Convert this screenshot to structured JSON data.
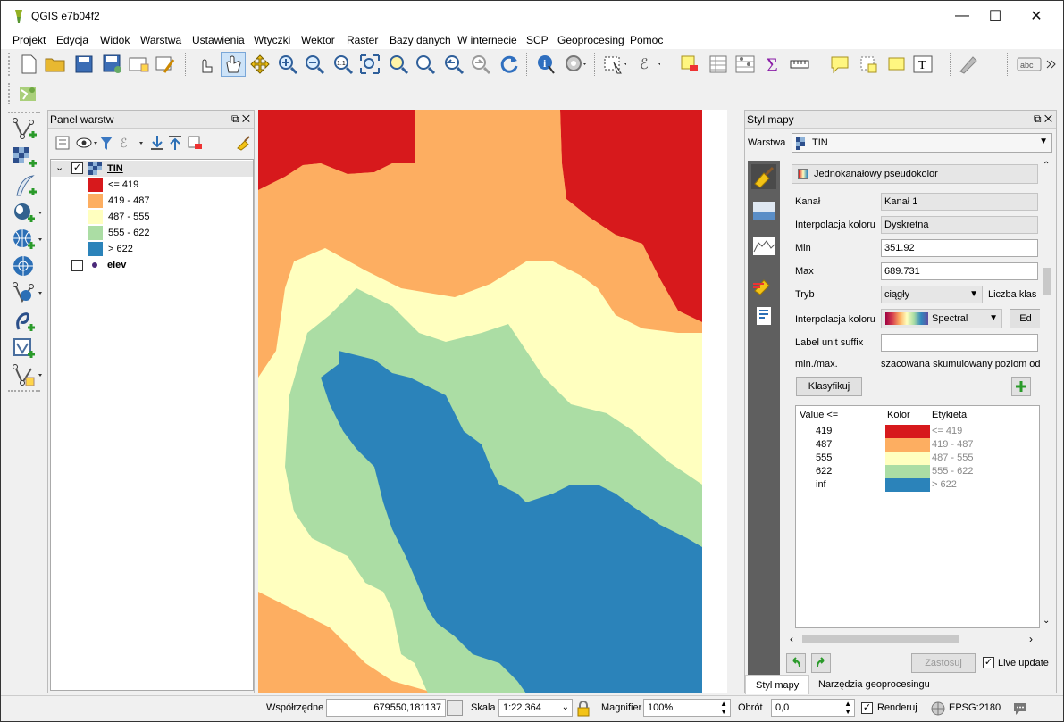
{
  "window": {
    "title": "QGIS e7b04f2"
  },
  "menu": [
    "Projekt",
    "Edycja",
    "Widok",
    "Warstwa",
    "Ustawienia",
    "Wtyczki",
    "Wektor",
    "Raster",
    "Bazy danych",
    "W internecie",
    "SCP",
    "Geoprocesing",
    "Pomoc"
  ],
  "layers_panel": {
    "title": "Panel warstw",
    "layers": [
      {
        "name": "TIN",
        "checked": true,
        "legend": [
          {
            "label": "<= 419",
            "color": "#d7191c"
          },
          {
            "label": "419 - 487",
            "color": "#fdae61"
          },
          {
            "label": "487 - 555",
            "color": "#ffffbf"
          },
          {
            "label": "555 - 622",
            "color": "#abdda4"
          },
          {
            "label": "> 622",
            "color": "#2b83ba"
          }
        ]
      },
      {
        "name": "elev",
        "checked": false
      }
    ]
  },
  "style_panel": {
    "title": "Styl mapy",
    "layer_label": "Warstwa",
    "layer_value": "TIN",
    "renderer": "Jednokanałowy pseudokolor",
    "band_label": "Kanał",
    "band_value": "Kanał 1",
    "interp_label": "Interpolacja koloru",
    "interp_value": "Dyskretna",
    "min_label": "Min",
    "min_value": "351.92",
    "max_label": "Max",
    "max_value": "689.731",
    "mode_label": "Tryb",
    "mode_value": "ciągły",
    "classes_label": "Liczba klas",
    "ramp_label": "Interpolacja koloru",
    "ramp_value": "Spectral",
    "edit_label": "Ed",
    "suffix_label": "Label unit suffix",
    "suffix_value": "",
    "minmax_label": "min./max.",
    "minmax_value": "szacowana skumulowany poziom odc",
    "classify_button": "Klasyfikuj",
    "table_headers": [
      "Value <=",
      "Kolor",
      "Etykieta"
    ],
    "table_rows": [
      {
        "value": "419",
        "color": "#d7191c",
        "label": "<= 419"
      },
      {
        "value": "487",
        "color": "#fdae61",
        "label": "419 - 487"
      },
      {
        "value": "555",
        "color": "#ffffbf",
        "label": "487 - 555"
      },
      {
        "value": "622",
        "color": "#abdda4",
        "label": "555 - 622"
      },
      {
        "value": "inf",
        "color": "#2b83ba",
        "label": "> 622"
      }
    ],
    "apply_button": "Zastosuj",
    "live_update_label": "Live update",
    "live_update_checked": true
  },
  "dock_tabs": [
    "Styl mapy",
    "Narzędzia geoprocesingu"
  ],
  "status": {
    "coord_label": "Współrzędne",
    "coord_value": "679550,181137",
    "scale_label": "Skala",
    "scale_value": "1:22 364",
    "magnifier_label": "Magnifier",
    "magnifier_value": "100%",
    "rotation_label": "Obrót",
    "rotation_value": "0,0",
    "render_label": "Renderuj",
    "render_checked": true,
    "crs_value": "EPSG:2180"
  }
}
